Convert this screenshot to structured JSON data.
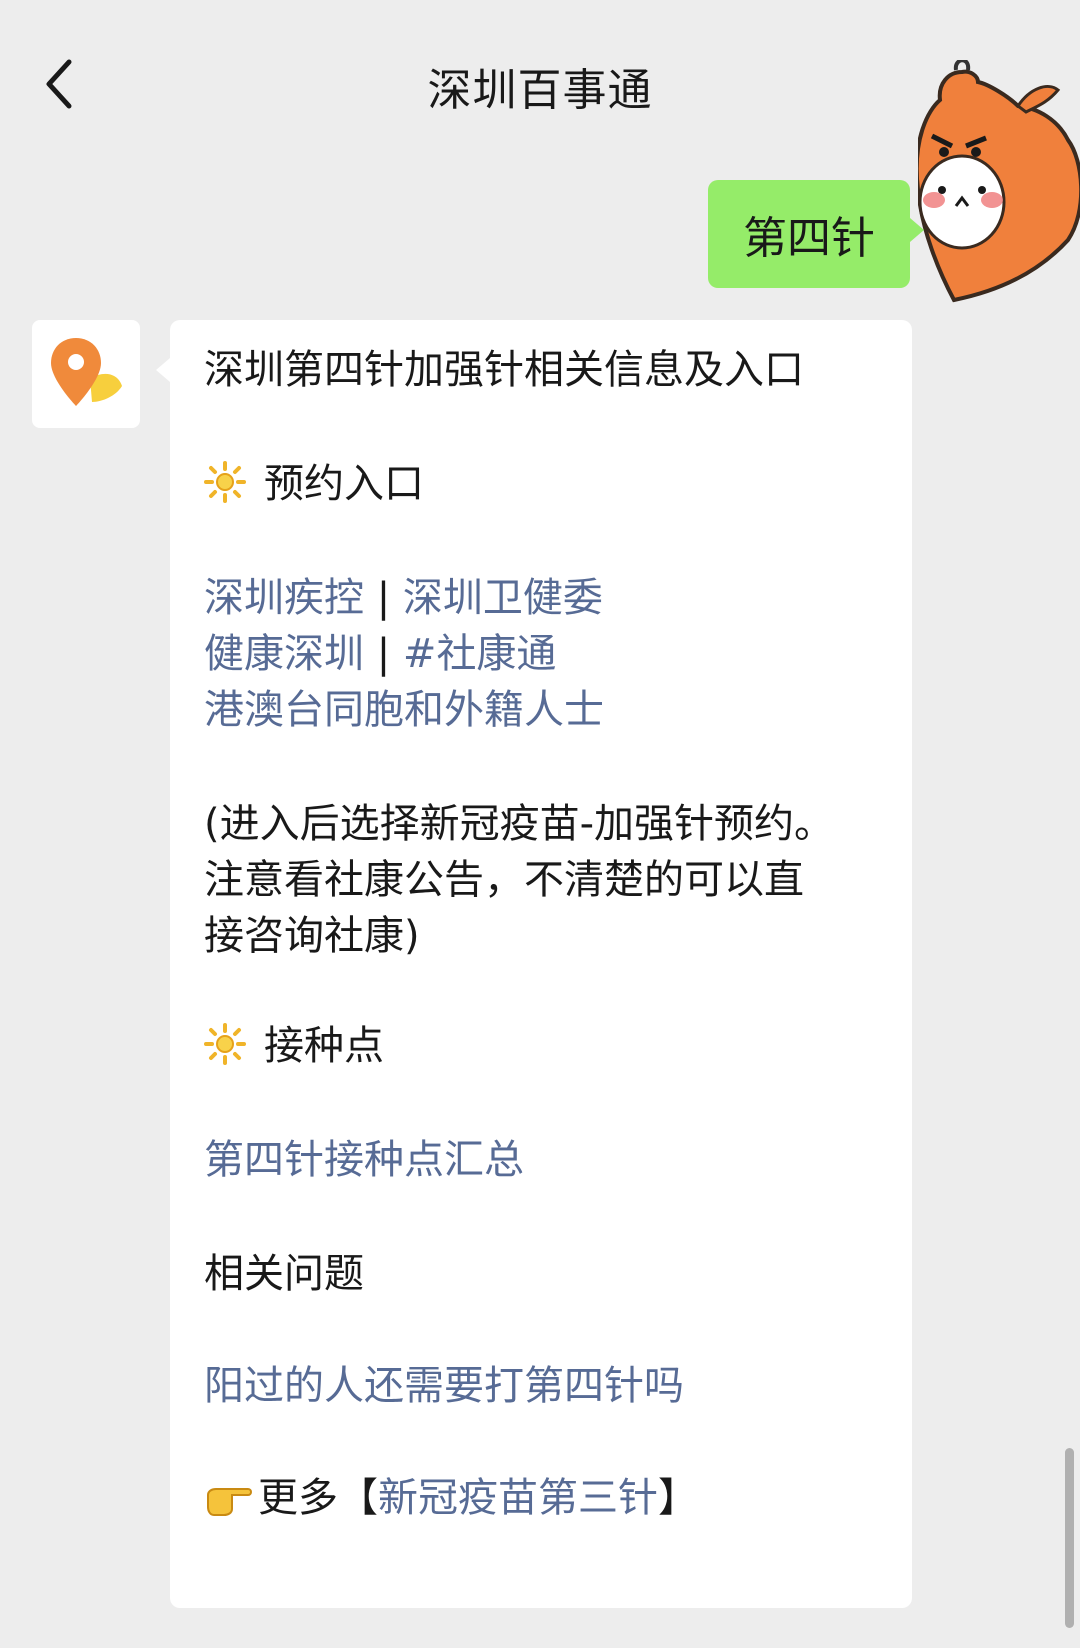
{
  "header": {
    "title": "深圳百事通",
    "back_icon": "chevron-left-icon"
  },
  "user_message": {
    "text": "第四针",
    "bubble_color": "#95ec69"
  },
  "bot_message": {
    "title": "深圳第四针加强针相关信息及入口",
    "section_booking": "预约入口",
    "links_row1": {
      "a": "深圳疾控",
      "sep": "|",
      "b": "深圳卫健委"
    },
    "links_row2": {
      "a": "健康深圳",
      "sep": "|",
      "b": "#社康通"
    },
    "links_row3": "港澳台同胞和外籍人士",
    "note_line1": "(进入后选择新冠疫苗-加强针预约。",
    "note_line2": "注意看社康公告，不清楚的可以直",
    "note_line3": "接咨询社康)",
    "section_sites": "接种点",
    "sites_link": "第四针接种点汇总",
    "related_label": "相关问题",
    "related_link": "阳过的人还需要打第四针吗",
    "more_prefix": "更多",
    "more_bracket_open": "【",
    "more_link": "新冠疫苗第三针",
    "more_bracket_close": "】"
  },
  "colors": {
    "background": "#ededed",
    "link": "#576b95",
    "text": "#191919"
  },
  "icons": {
    "sun": "sun-icon",
    "pointing_hand": "pointing-hand-icon",
    "location_pin": "location-pin-icon"
  }
}
